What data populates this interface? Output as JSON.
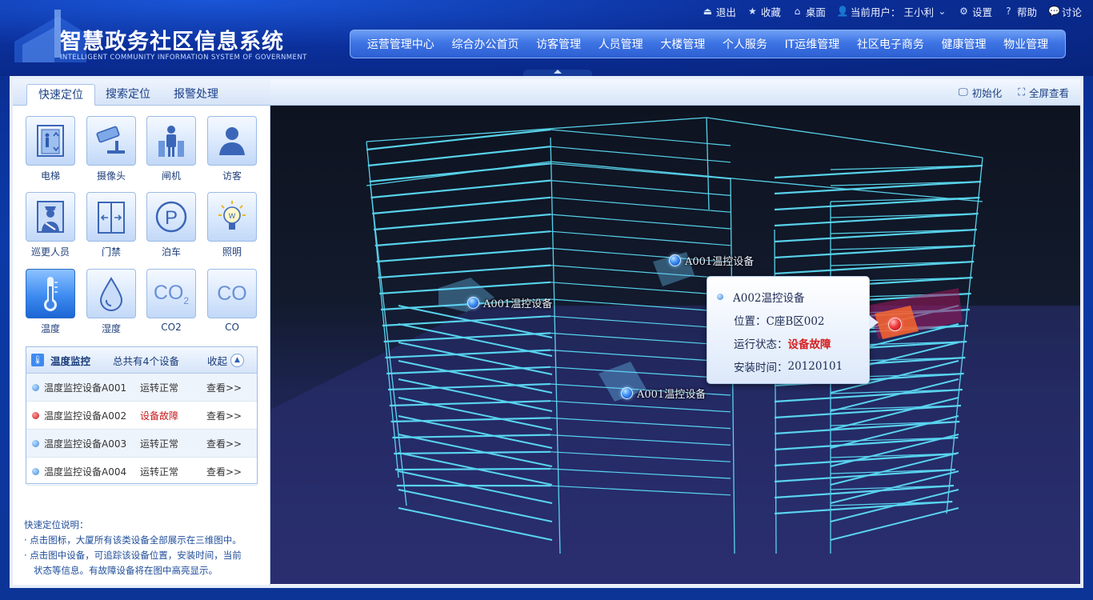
{
  "header": {
    "title": "智慧政务社区信息系统",
    "subtitle": "INTELLIGENT COMMUNITY INFORMATION SYSTEM OF GOVERNMENT"
  },
  "topbar": {
    "logout": "退出",
    "favorites": "收藏",
    "desktop": "桌面",
    "current_user_label": "当前用户：",
    "current_user": "王小利",
    "settings": "设置",
    "help": "帮助",
    "discuss": "讨论"
  },
  "nav": [
    "运营管理中心",
    "综合办公首页",
    "访客管理",
    "人员管理",
    "大楼管理",
    "个人服务",
    "IT运维管理",
    "社区电子商务",
    "健康管理",
    "物业管理"
  ],
  "tabs": [
    "快速定位",
    "搜索定位",
    "报警处理"
  ],
  "icons": [
    {
      "label": "电梯",
      "icon": "elevator-icon"
    },
    {
      "label": "摄像头",
      "icon": "camera-icon"
    },
    {
      "label": "闸机",
      "icon": "gate-icon"
    },
    {
      "label": "访客",
      "icon": "visitor-icon"
    },
    {
      "label": "巡更人员",
      "icon": "patrol-icon"
    },
    {
      "label": "门禁",
      "icon": "door-access-icon"
    },
    {
      "label": "泊车",
      "icon": "parking-icon"
    },
    {
      "label": "照明",
      "icon": "lighting-icon"
    },
    {
      "label": "温度",
      "icon": "thermometer-icon"
    },
    {
      "label": "湿度",
      "icon": "humidity-icon"
    },
    {
      "label": "CO2",
      "icon": "co2-icon"
    },
    {
      "label": "CO",
      "icon": "co-icon"
    }
  ],
  "monitor": {
    "title": "温度监控",
    "count": "总共有4个设备",
    "collapse": "收起",
    "rows": [
      {
        "name": "温度监控设备A001",
        "status": "运转正常",
        "action": "查看>>",
        "fault": false
      },
      {
        "name": "温度监控设备A002",
        "status": "设备故障",
        "action": "查看>>",
        "fault": true
      },
      {
        "name": "温度监控设备A003",
        "status": "运转正常",
        "action": "查看>>",
        "fault": false
      },
      {
        "name": "温度监控设备A004",
        "status": "运转正常",
        "action": "查看>>",
        "fault": false
      }
    ]
  },
  "notes": {
    "title": "快速定位说明：",
    "line1": "· 点击图标，大厦所有该类设备全部展示在三维图中。",
    "line2": "· 点击图中设备，可追踪该设备位置，安装时间，当前",
    "line3": "状态等信息。有故障设备将在图中高亮显示。"
  },
  "toolbar": {
    "init": "初始化",
    "fullscreen": "全屏查看"
  },
  "markers": [
    "A001温控设备",
    "A001温控设备",
    "A001温控设备"
  ],
  "popup": {
    "title": "A002温控设备",
    "location_label": "位置：",
    "location": "C座B区002",
    "status_label": "运行状态：",
    "status": "设备故障",
    "install_label": "安装时间：",
    "install": "20120101"
  },
  "colors": {
    "accent": "#2c5fd3",
    "fault": "#d51f1f",
    "wireframe": "#5fe6ff"
  }
}
